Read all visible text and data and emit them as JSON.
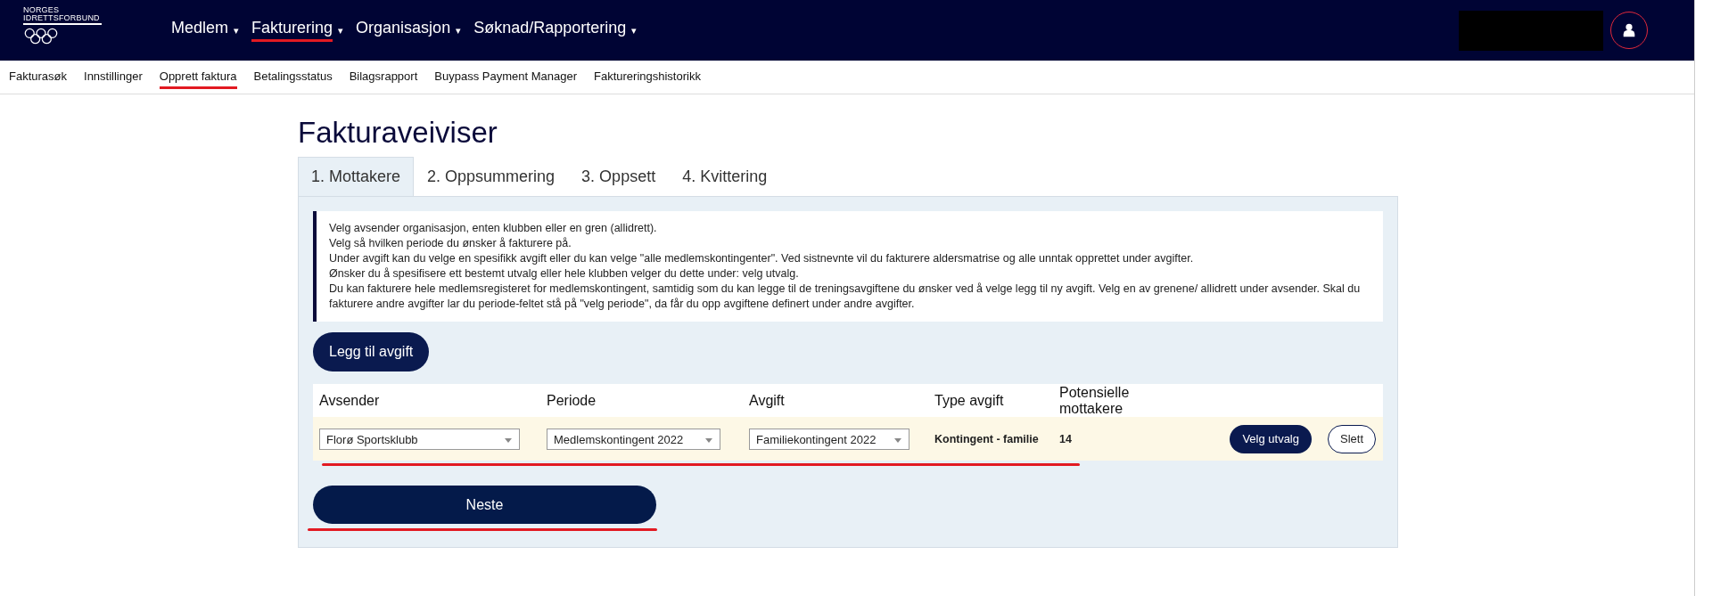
{
  "header": {
    "logo_text": [
      "NORGES",
      "IDRETTSFORBUND"
    ],
    "nav": [
      {
        "label": "Medlem",
        "caret": "▾",
        "underlined": false
      },
      {
        "label": "Fakturering",
        "caret": "▾",
        "underlined": true
      },
      {
        "label": "Organisasjon",
        "caret": "▾",
        "underlined": false
      },
      {
        "label": "Søknad/Rapportering",
        "caret": "▾",
        "underlined": false
      }
    ]
  },
  "subnav": [
    {
      "label": "Fakturasøk",
      "underlined": false
    },
    {
      "label": "Innstillinger",
      "underlined": false
    },
    {
      "label": "Opprett faktura",
      "underlined": true
    },
    {
      "label": "Betalingsstatus",
      "underlined": false
    },
    {
      "label": "Bilagsrapport",
      "underlined": false
    },
    {
      "label": "Buypass Payment Manager",
      "underlined": false
    },
    {
      "label": "Faktureringshistorikk",
      "underlined": false
    }
  ],
  "page_title": "Fakturaveiviser",
  "tabs": [
    {
      "label": "1. Mottakere",
      "selected": true
    },
    {
      "label": "2. Oppsummering",
      "selected": false
    },
    {
      "label": "3. Oppsett",
      "selected": false
    },
    {
      "label": "4. Kvittering",
      "selected": false
    }
  ],
  "info_lines": [
    "Velg avsender organisasjon, enten klubben eller en gren (allidrett).",
    "Velg så hvilken periode du ønsker å fakturere på.",
    "Under avgift kan du velge en spesifikk avgift eller du kan velge \"alle medlemskontingenter\". Ved sistnevnte vil du fakturere aldersmatrise og alle unntak opprettet under avgifter.",
    "Ønsker du å spesifisere ett bestemt utvalg eller hele klubben velger du dette under: velg utvalg.",
    "Du kan fakturere hele medlemsregisteret for medlemskontingent, samtidig som du kan legge til de treningsavgiftene du ønsker ved å velge legg til ny avgift. Velg en av grenene/ allidrett under avsender. Skal du fakturere andre avgifter lar du periode-feltet stå på \"velg periode\", da får du opp avgiftene definert under andre avgifter."
  ],
  "add_button": "Legg til avgift",
  "table": {
    "columns": [
      "Avsender",
      "Periode",
      "Avgift",
      "Type avgift",
      "Potensielle mottakere"
    ],
    "rows": [
      {
        "avsender": "Florø Sportsklubb",
        "periode": "Medlemskontingent 2022",
        "avgift": "Familiekontingent 2022",
        "type": "Kontingent - familie",
        "mottakere": "14",
        "select_button": "Velg utvalg",
        "delete_button": "Slett",
        "underlined": true
      }
    ]
  },
  "next_button": {
    "label": "Neste",
    "underlined": true
  }
}
